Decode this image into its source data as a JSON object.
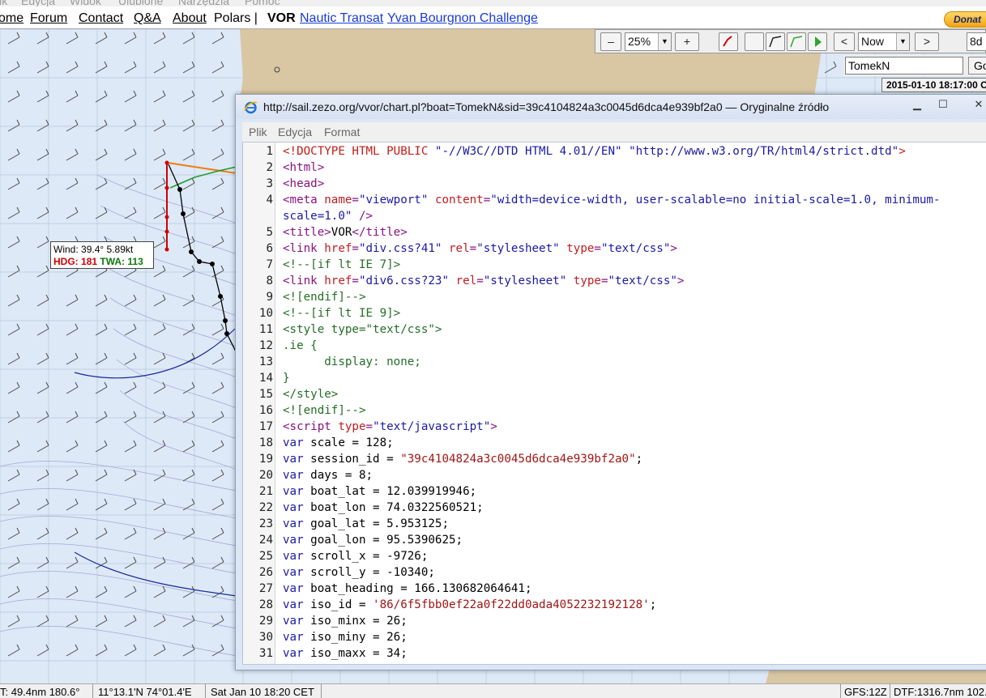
{
  "browser_menu": [
    "lik",
    "Edycja",
    "Widok",
    "Ulubione",
    "Narzędzia",
    "Pomoc"
  ],
  "site_nav": {
    "home": "ome",
    "forum": "Forum",
    "contact": "Contact",
    "qa": "Q&A",
    "about": "About",
    "polars": "Polars |",
    "vor": "VOR",
    "races": [
      "Nautic Transat",
      "Yvan Bourgnon Challenge"
    ],
    "donate": "Donat"
  },
  "toolbar": {
    "zoom_out": "–",
    "zoom_value": "25%",
    "zoom_in": "+",
    "prev": "<",
    "time_select": "Now",
    "next": ">",
    "days": "8d",
    "boat_name": "TomekN",
    "go": "Go",
    "map_time": "2015-01-10 18:17:00 C"
  },
  "wind_box": {
    "wind_label": "Wind:",
    "wind_value": "39.4° 5.89kt",
    "hdg_label": "HDG:",
    "hdg_value": "181",
    "twa_label": "TWA:",
    "twa_value": "113"
  },
  "source_window": {
    "title": "http://sail.zezo.org/vvor/chart.pl?boat=TomekN&sid=39c4104824a3c0045d6dca4e939bf2a0 — Oryginalne źródło",
    "minimize": "▁",
    "maximize": "☐",
    "close": "✕",
    "menu": [
      "Plik",
      "Edycja",
      "Format"
    ],
    "lines": [
      {
        "n": "1",
        "html": "<span class='t-red'>&lt;!DOCTYPE HTML PUBLIC </span><span class='t-blue'>\"-//W3C//DTD HTML 4.01//EN\" \"http://www.w3.org/TR/html4/strict.dtd\"</span><span class='t-red'>&gt;</span>"
      },
      {
        "n": "2",
        "html": "<span class='t-tag'>&lt;html&gt;</span>"
      },
      {
        "n": "3",
        "html": "<span class='t-tag'>&lt;head&gt;</span>"
      },
      {
        "n": "4",
        "html": "<span class='t-tag'>&lt;meta </span><span class='t-attr'>name</span><span class='t-tag'>=</span><span class='t-blue'>\"viewport\"</span> <span class='t-attr'>content</span><span class='t-tag'>=</span><span class='t-blue'>\"width=device-width, user-scalable=no initial-scale=1.0, minimum-scale=1.0\"</span> <span class='t-tag'>/&gt;</span>",
        "tall": true
      },
      {
        "n": "5",
        "html": "<span class='t-tag'>&lt;title&gt;</span><span class='t-plain'>VOR</span><span class='t-tag'>&lt;/title&gt;</span>"
      },
      {
        "n": "6",
        "html": "<span class='t-tag'>&lt;link </span><span class='t-attr'>href</span><span class='t-tag'>=</span><span class='t-blue'>\"div.css?41\"</span> <span class='t-attr'>rel</span><span class='t-tag'>=</span><span class='t-blue'>\"stylesheet\"</span> <span class='t-attr'>type</span><span class='t-tag'>=</span><span class='t-blue'>\"text/css\"</span><span class='t-tag'>&gt;</span>"
      },
      {
        "n": "7",
        "html": "<span class='t-green'>&lt;!--[if lt IE 7]&gt;</span>"
      },
      {
        "n": "8",
        "html": "<span class='t-tag'>&lt;link </span><span class='t-attr'>href</span><span class='t-tag'>=</span><span class='t-blue'>\"div6.css?23\"</span> <span class='t-attr'>rel</span><span class='t-tag'>=</span><span class='t-blue'>\"stylesheet\"</span> <span class='t-attr'>type</span><span class='t-tag'>=</span><span class='t-blue'>\"text/css\"</span><span class='t-tag'>&gt;</span>"
      },
      {
        "n": "9",
        "html": "<span class='t-green'>&lt;![endif]--&gt;</span>"
      },
      {
        "n": "10",
        "html": "<span class='t-green'>&lt;!--[if lt IE 9]&gt;</span>"
      },
      {
        "n": "11",
        "html": "<span class='t-green'>&lt;style type=\"text/css\"&gt;</span>"
      },
      {
        "n": "12",
        "html": "<span class='t-green'>.ie {</span>"
      },
      {
        "n": "13",
        "html": "<span class='t-green'>      display: none;</span>"
      },
      {
        "n": "14",
        "html": "<span class='t-green'>}</span>"
      },
      {
        "n": "15",
        "html": "<span class='t-green'>&lt;/style&gt;</span>"
      },
      {
        "n": "16",
        "html": "<span class='t-green'>&lt;![endif]--&gt;</span>"
      },
      {
        "n": "17",
        "html": "<span class='t-tag'>&lt;script </span><span class='t-attr'>type</span><span class='t-tag'>=</span><span class='t-blue'>\"text/javascript\"</span><span class='t-tag'>&gt;</span>"
      },
      {
        "n": "18",
        "html": "<span class='t-var'>var</span> scale = 128;"
      },
      {
        "n": "19",
        "html": "<span class='t-var'>var</span> session_id = <span class='t-strval'>\"39c4104824a3c0045d6dca4e939bf2a0\"</span>;"
      },
      {
        "n": "20",
        "html": "<span class='t-var'>var</span> days = 8;"
      },
      {
        "n": "21",
        "html": "<span class='t-var'>var</span> boat_lat = 12.039919946;"
      },
      {
        "n": "22",
        "html": "<span class='t-var'>var</span> boat_lon = 74.0322560521;"
      },
      {
        "n": "23",
        "html": "<span class='t-var'>var</span> goal_lat = 5.953125;"
      },
      {
        "n": "24",
        "html": "<span class='t-var'>var</span> goal_lon = 95.5390625;"
      },
      {
        "n": "25",
        "html": "<span class='t-var'>var</span> scroll_x = -9726;"
      },
      {
        "n": "26",
        "html": "<span class='t-var'>var</span> scroll_y = -10340;"
      },
      {
        "n": "27",
        "html": "<span class='t-var'>var</span> boat_heading = 166.130682064641;"
      },
      {
        "n": "28",
        "html": "<span class='t-var'>var</span> iso_id = <span class='t-strval'>'86/6f5fbb0ef22a0f22dd0ada4052232192128'</span>;"
      },
      {
        "n": "29",
        "html": "<span class='t-var'>var</span> iso_minx = 26;"
      },
      {
        "n": "30",
        "html": "<span class='t-var'>var</span> iso_miny = 26;"
      },
      {
        "n": "31",
        "html": "<span class='t-var'>var</span> iso_maxx = 34;"
      }
    ]
  },
  "status_bar": {
    "dtw": "T:  49.4nm 180.6°",
    "position": "11°13.1'N 74°01.4'E",
    "time": "Sat Jan 10 18:20 CET",
    "gfs": "GFS:12Z",
    "dtf": "DTF:1316.7nm 102."
  },
  "colors": {
    "sea": "#dde9f7",
    "land": "#d9c6a3",
    "route": "#d00000",
    "track": "#000000",
    "orange_line": "#f07c10",
    "green_line": "#1f9a2f",
    "isochrone": "#1a2a9a"
  }
}
